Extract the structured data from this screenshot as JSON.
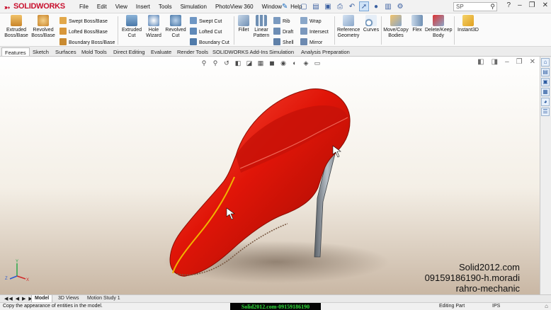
{
  "app": {
    "name": "SOLIDWORKS"
  },
  "menu": [
    "File",
    "Edit",
    "View",
    "Insert",
    "Tools",
    "Simulation",
    "PhotoView 360",
    "Window",
    "Help"
  ],
  "search": {
    "placeholder": "SP"
  },
  "ribbon": {
    "extruded_boss": "Extruded Boss/Base",
    "revolved_boss": "Revolved Boss/Base",
    "swept_boss": "Swept Boss/Base",
    "lofted_boss": "Lofted Boss/Base",
    "boundary_boss": "Boundary Boss/Base",
    "extruded_cut": "Extruded Cut",
    "hole_wizard": "Hole Wizard",
    "revolved_cut": "Revolved Cut",
    "swept_cut": "Swept Cut",
    "lofted_cut": "Lofted Cut",
    "boundary_cut": "Boundary Cut",
    "fillet": "Fillet",
    "linear_pattern": "Linear Pattern",
    "rib": "Rib",
    "draft": "Draft",
    "shell": "Shell",
    "wrap": "Wrap",
    "intersect": "Intersect",
    "mirror": "Mirror",
    "reference_geometry": "Reference Geometry",
    "curves": "Curves",
    "move_copy": "Move/Copy Bodies",
    "flex": "Flex",
    "delete_keep": "Delete/Keep Body",
    "instant3d": "Instant3D"
  },
  "tabs": [
    "Features",
    "Sketch",
    "Surfaces",
    "Mold Tools",
    "Direct Editing",
    "Evaluate",
    "Render Tools",
    "SOLIDWORKS Add-Ins",
    "Simulation",
    "Analysis Preparation"
  ],
  "active_tab": "Features",
  "watermark": {
    "line1": "Solid2012.com",
    "line2": "09159186190-h.moradi",
    "line3": "rahro-mechanic"
  },
  "triad": {
    "y": "Y",
    "x": "X",
    "z": "Z"
  },
  "bottom_tabs": [
    "Model",
    "3D Views",
    "Motion Study 1"
  ],
  "status": {
    "message": "Copy the appearance of entities in the model.",
    "banner": "Solid2012.com-09159186190",
    "mode": "Editing Part",
    "units": "IPS"
  },
  "colors": {
    "shoe": "#e01508",
    "heel": "#8a929a",
    "accent": "#c8102e",
    "banner_text": "#2fe03a"
  }
}
